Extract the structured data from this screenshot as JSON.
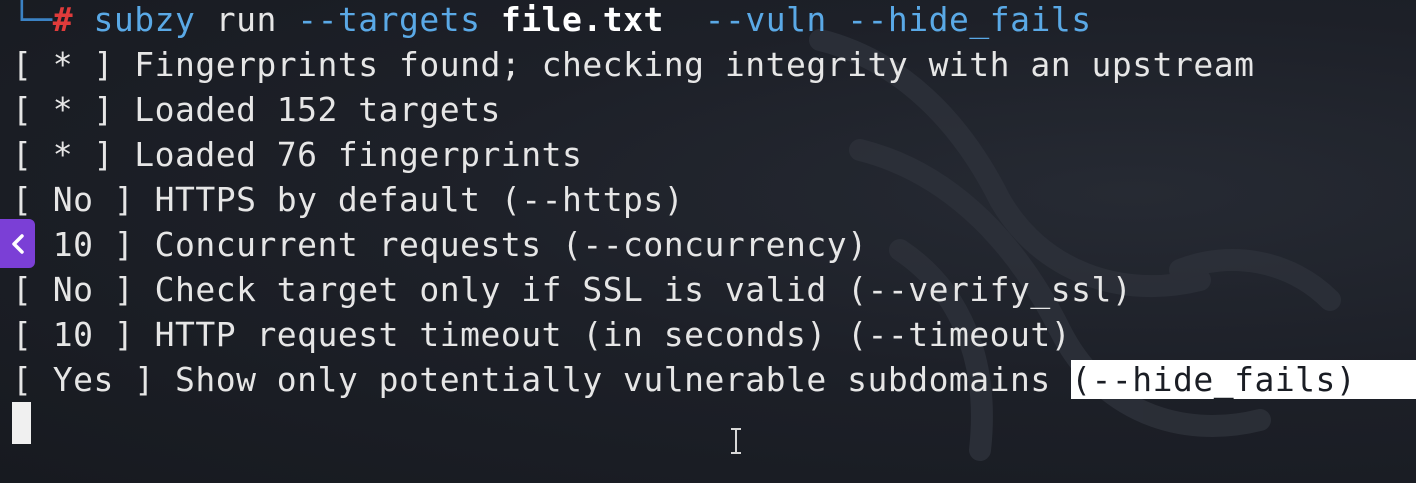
{
  "terminal": {
    "prompt": {
      "corner": "└─",
      "hash": "#",
      "command_name": "subzy",
      "arg_run": "run",
      "flag_targets": "--targets",
      "file": "file.txt",
      "flag_vuln": "--vuln",
      "flag_hide_fails": "--hide_fails"
    },
    "output": [
      {
        "open": "[",
        "tag": " * ",
        "close": "]",
        "text": " Fingerprints found; checking integrity with an upstream"
      },
      {
        "open": "[",
        "tag": " * ",
        "close": "]",
        "text": " Loaded 152 targets"
      },
      {
        "open": "[",
        "tag": " * ",
        "close": "]",
        "text": " Loaded 76 fingerprints"
      },
      {
        "open": "[",
        "tag": " No ",
        "close": "]",
        "text": " HTTPS by default (--https)"
      },
      {
        "open": "[",
        "tag": " 10 ",
        "close": "]",
        "text": " Concurrent requests (--concurrency)"
      },
      {
        "open": "[",
        "tag": " No ",
        "close": "]",
        "text": " Check target only if SSL is valid (--verify_ssl)"
      },
      {
        "open": "[",
        "tag": " 10 ",
        "close": "]",
        "text": " HTTP request timeout (in seconds) (--timeout)"
      }
    ],
    "last_line": {
      "open": "[",
      "tag": " Yes ",
      "close": "]",
      "text": " Show only potentially vulnerable subdomains ",
      "highlighted": "(--hide_fails)"
    }
  },
  "colors": {
    "background": "#1a1d24",
    "prompt_blue": "#5aa9e6",
    "prompt_red": "#e03b3b",
    "side_tab": "#7b3fd6"
  },
  "icons": {
    "side_tab": "chevron-left-icon",
    "mouse": "text-ibeam-icon"
  }
}
